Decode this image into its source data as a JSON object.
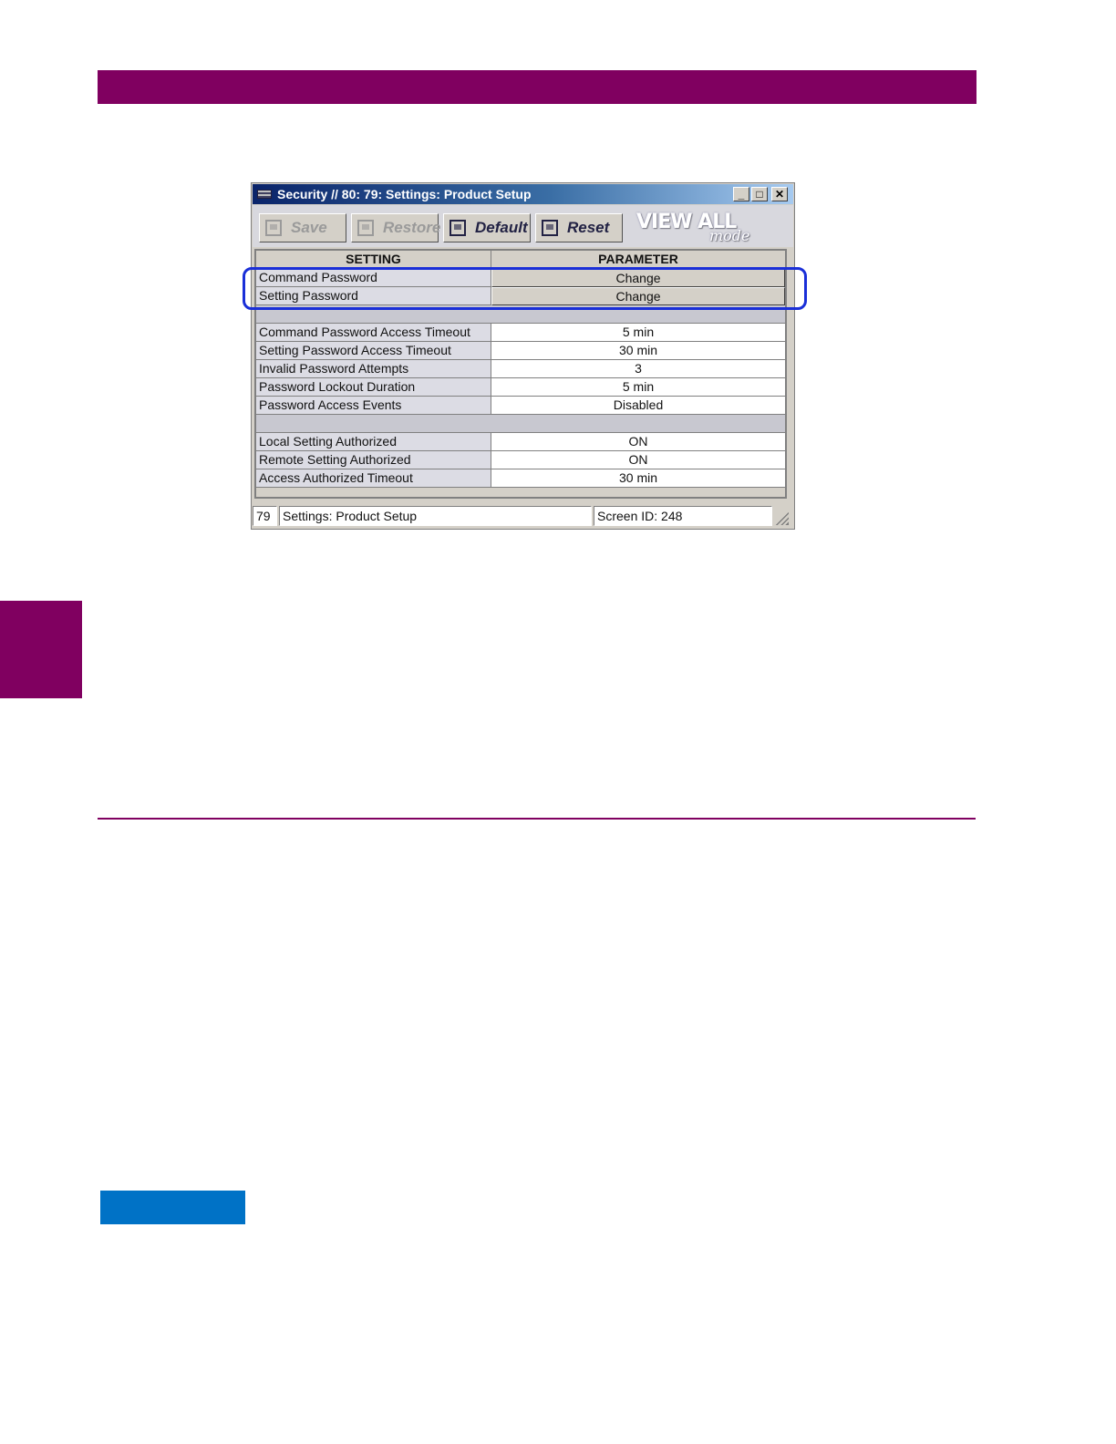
{
  "window": {
    "title": "Security // 80: 79: Settings: Product Setup",
    "controls": {
      "minimize": "_",
      "maximize": "□",
      "close": "✕"
    }
  },
  "toolbar": {
    "save_label": "Save",
    "restore_label": "Restore",
    "default_label": "Default",
    "reset_label": "Reset",
    "view_all_label": "VIEW ALL",
    "mode_label": "mode"
  },
  "grid": {
    "headers": {
      "setting": "SETTING",
      "parameter": "PARAMETER"
    },
    "group1": [
      {
        "setting": "Command Password",
        "value": "Change"
      },
      {
        "setting": "Setting Password",
        "value": "Change"
      }
    ],
    "group2": [
      {
        "setting": "Command Password Access Timeout",
        "value": "5 min"
      },
      {
        "setting": "Setting Password Access Timeout",
        "value": "30 min"
      },
      {
        "setting": "Invalid Password Attempts",
        "value": "3"
      },
      {
        "setting": "Password Lockout Duration",
        "value": "5 min"
      },
      {
        "setting": "Password Access Events",
        "value": "Disabled"
      }
    ],
    "group3": [
      {
        "setting": "Local Setting Authorized",
        "value": "ON"
      },
      {
        "setting": "Remote Setting Authorized",
        "value": "ON"
      },
      {
        "setting": "Access Authorized Timeout",
        "value": "30 min"
      }
    ]
  },
  "statusbar": {
    "number": "79",
    "location": "Settings: Product Setup",
    "screen_id": "Screen ID: 248"
  },
  "colors": {
    "header_bar": "#800060",
    "note_box": "#0072c6",
    "highlight": "#1a2fd8"
  }
}
